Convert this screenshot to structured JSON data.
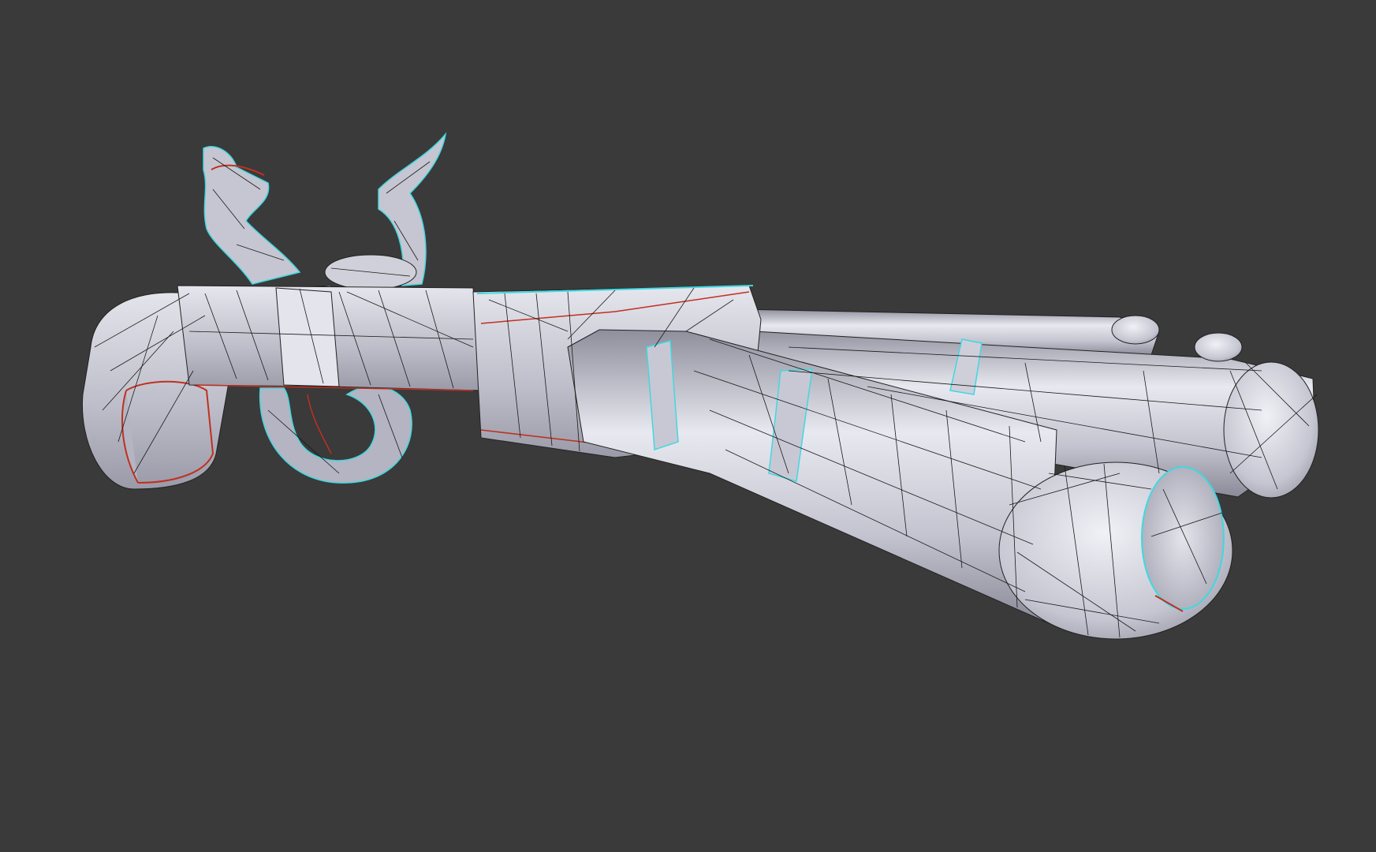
{
  "viewport": {
    "background": "#3a3a3a",
    "mode": "solid-wireframe",
    "object": "flintlock-pistol-mesh"
  },
  "colors": {
    "mesh_fill_light": "#d8d8e2",
    "mesh_fill_mid": "#b4b4c2",
    "mesh_fill_dark": "#8c8c9a",
    "wire": "#1a1a1a",
    "seam_edge": "#c03020",
    "boundary_edge": "#40d8e0"
  }
}
